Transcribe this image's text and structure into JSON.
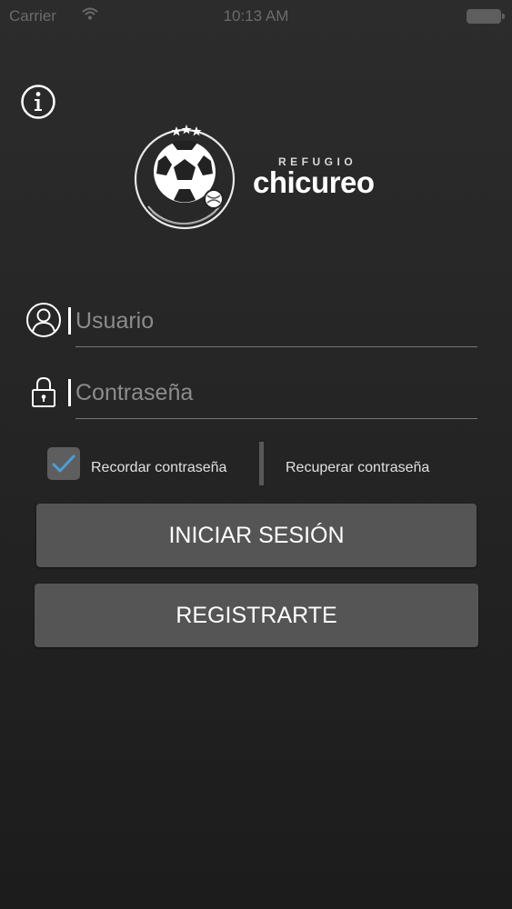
{
  "status_bar": {
    "carrier": "Carrier",
    "time": "10:13 AM"
  },
  "logo": {
    "small_text": "REFUGIO",
    "brand": "chicureo"
  },
  "login_form": {
    "username": {
      "placeholder": "Usuario",
      "value": ""
    },
    "password": {
      "placeholder": "Contraseña",
      "value": ""
    },
    "remember_label": "Recordar contraseña",
    "remember_checked": true,
    "recover_label": "Recuperar contraseña",
    "login_label": "INICIAR SESIÓN",
    "register_label": "REGISTRARTE"
  },
  "icons": {
    "info": "info-icon",
    "user": "user-icon",
    "lock": "lock-icon",
    "check": "checkmark-icon"
  },
  "colors": {
    "background": "#262626",
    "button": "#555555",
    "checkmark": "#4a9fd8",
    "text": "#ffffff",
    "placeholder": "#8c8c8c"
  }
}
